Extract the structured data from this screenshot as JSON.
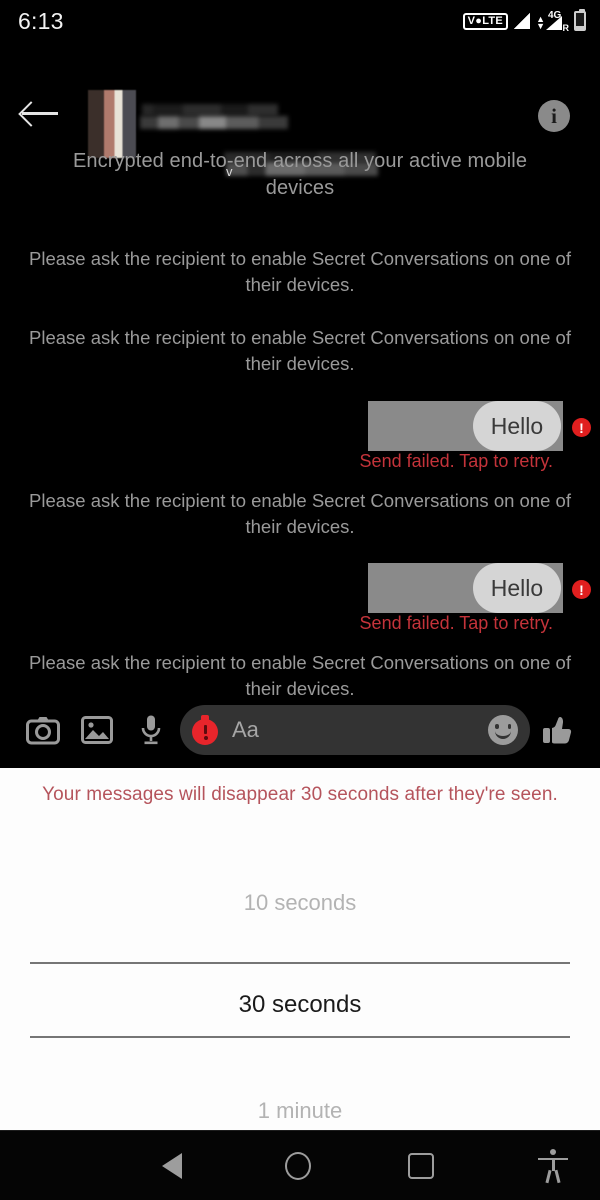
{
  "statusbar": {
    "time": "6:13",
    "volte_label": "V●LTE",
    "network_label": "4G",
    "network_plus": "+",
    "roaming_label": "R",
    "signal_icon": "signal-triangle-icon",
    "battery_icon": "battery-low-icon"
  },
  "header": {
    "back_icon": "back-arrow-icon",
    "avatar_name": "avatar-blurred",
    "contact_name_redacted": "",
    "contact_subtitle_redacted": "",
    "caret": "v",
    "info_label": "i",
    "info_icon": "info-circle-icon"
  },
  "thread": {
    "encryption_notice": "Encrypted end-to-end across all your active mobile devices",
    "items": [
      {
        "type": "system",
        "text": "Please ask the recipient to enable Secret Conversations on one of their devices."
      },
      {
        "type": "system",
        "text": "Please ask the recipient to enable Secret Conversations on one of their devices."
      },
      {
        "type": "outgoing",
        "text": "Hello",
        "status": "Send failed. Tap to retry.",
        "error_glyph": "!"
      },
      {
        "type": "system",
        "text": "Please ask the recipient to enable Secret Conversations on one of their devices."
      },
      {
        "type": "outgoing",
        "text": "Hello",
        "status": "Send failed. Tap to retry.",
        "error_glyph": "!"
      },
      {
        "type": "system",
        "text": "Please ask the recipient to enable Secret Conversations on one of their devices."
      }
    ],
    "msg1_text": "Hello",
    "msg1_status": "Send failed. Tap to retry.",
    "msg2_text": "Hello",
    "msg2_status": "Send failed. Tap to retry.",
    "sys1": "Please ask the recipient to enable Secret Conversations on one of their devices.",
    "sys2": "Please ask the recipient to enable Secret Conversations on one of their devices.",
    "sys3": "Please ask the recipient to enable Secret Conversations on one of their devices.",
    "sys4": "Please ask the recipient to enable Secret Conversations on one of their devices.",
    "error_glyph": "!"
  },
  "composer": {
    "camera_icon": "camera-icon",
    "gallery_icon": "image-gallery-icon",
    "mic_icon": "microphone-icon",
    "timer_icon": "stopwatch-timer-icon",
    "placeholder": "Aa",
    "emoji_icon": "smiley-face-icon",
    "like_icon": "thumbs-up-icon"
  },
  "timer_sheet": {
    "note": "Your messages will disappear 30 seconds after they're seen.",
    "options": [
      "10 seconds",
      "30 seconds",
      "1 minute"
    ],
    "option_above": "10 seconds",
    "option_selected": "30 seconds",
    "option_below": "1 minute",
    "selected_index": 1,
    "accent_color": "#b5545c"
  },
  "navbar": {
    "back_icon": "nav-back-triangle-icon",
    "home_icon": "nav-home-circle-icon",
    "recents_icon": "nav-recents-square-icon",
    "accessibility_icon": "accessibility-person-icon"
  },
  "colors": {
    "background": "#000000",
    "sheet_background": "#fdfdfd",
    "error_red": "#c4333a",
    "timer_red": "#e8252b",
    "bubble": "#d5d5d5",
    "highlight": "#8a8a8a"
  }
}
